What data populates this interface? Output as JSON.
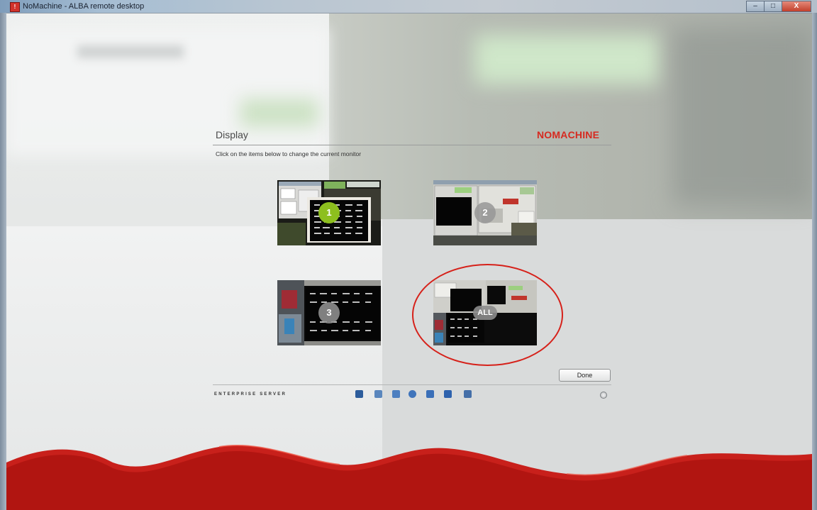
{
  "window": {
    "title": "NoMachine - ALBA remote desktop",
    "app_icon": "nomachine-logo-icon",
    "controls": [
      "–",
      "□",
      "X"
    ]
  },
  "dialog": {
    "heading": "Display",
    "brand": "NOMACHINE",
    "instruction": "Click on the items below to change the current monitor",
    "monitors": [
      {
        "label": "1",
        "selected": true
      },
      {
        "label": "2",
        "selected": false
      },
      {
        "label": "3",
        "selected": false
      },
      {
        "label": "ALL",
        "selected": false,
        "annotated": true
      }
    ],
    "done_button": "Done",
    "edition": "ENTERPRISE SERVER",
    "toolbar_icons": [
      "connection-icon",
      "display-icon",
      "input-icon",
      "audio-icon",
      "devices-icon",
      "screen-icon",
      "record-icon"
    ],
    "settings_icon": "gear-icon"
  },
  "colors": {
    "brand_red": "#d62a20",
    "badge_green": "#8dbf1e",
    "annotation_red": "#d6211a",
    "wave_red": "#c8201b"
  }
}
